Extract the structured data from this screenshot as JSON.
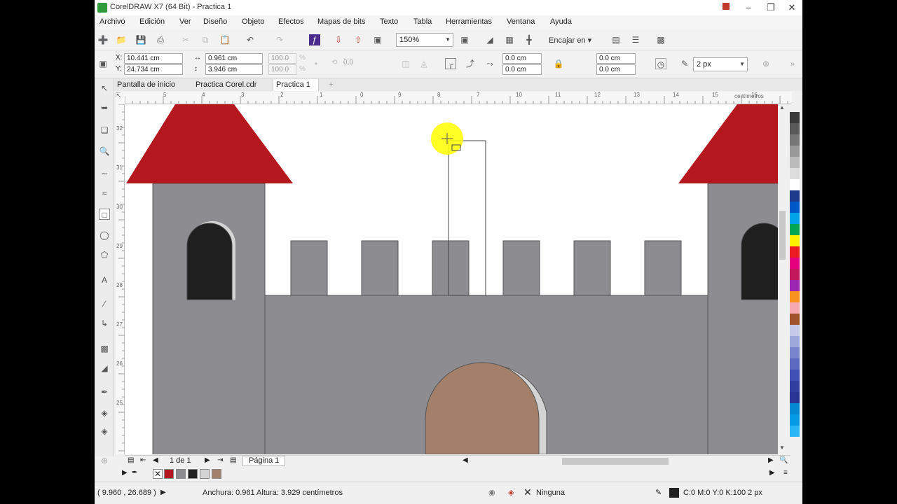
{
  "window": {
    "title": "CorelDRAW X7 (64 Bit) - Practica 1"
  },
  "menu": [
    "Archivo",
    "Edición",
    "Ver",
    "Diseño",
    "Objeto",
    "Efectos",
    "Mapas de bits",
    "Texto",
    "Tabla",
    "Herramientas",
    "Ventana",
    "Ayuda"
  ],
  "standard_toolbar": {
    "zoom": "150%",
    "snap_label": "Encajar en"
  },
  "property_bar": {
    "x_label": "X:",
    "x_value": "10.441 cm",
    "y_label": "Y:",
    "y_value": "24.734 cm",
    "width_value": "0.961 cm",
    "height_value": "3.946 cm",
    "scale_w": "100.0",
    "scale_h": "100.0",
    "pct": "%",
    "rotation": "0.0",
    "corner1": "0.0 cm",
    "corner2": "0.0 cm",
    "corner3": "0.0 cm",
    "corner4": "0.0 cm",
    "outline_width": "2 px"
  },
  "tabs": [
    "Pantalla de inicio",
    "Practica Corel.cdr",
    "Practica 1"
  ],
  "active_tab": "Practica 1",
  "ruler": {
    "unit": "centímetros",
    "h_ticks": [
      "5",
      "4",
      "3",
      "2",
      "1",
      "0",
      "9",
      "8",
      "7",
      "10",
      "11",
      "12",
      "13",
      "14",
      "15",
      "16",
      "17"
    ],
    "v_ticks": [
      "32",
      "31",
      "30",
      "29",
      "28",
      "27",
      "26",
      "25"
    ],
    "v_unit": "centímetros"
  },
  "page_nav": {
    "counter": "1 de 1",
    "page_tab": "Página 1"
  },
  "document_palette": {
    "colors": [
      "#b5171e",
      "#8d8d91",
      "#1f1f1f",
      "#d4d4d4",
      "#a47f6a"
    ]
  },
  "status": {
    "cursor": "( 9.960 , 26.689 )",
    "dimensions": "Anchura: 0.961  Altura: 3.929  centímetros",
    "fill": "Ninguna",
    "outline": "C:0 M:0 Y:0 K:100  2 px"
  },
  "drawing_colors": {
    "roof": "#b5171e",
    "stone": "#8d8d91",
    "window": "#1f1f1f",
    "door": "#a47f6a",
    "highlight": "#d4d4d4",
    "cursor_halo": "#ffff00"
  },
  "color_palette": [
    "#3a3a3a",
    "#5a5a5a",
    "#777777",
    "#999999",
    "#bbbbbb",
    "#dddddd",
    "#ffffff",
    "#1e3a8a",
    "#0059c9",
    "#00a2e8",
    "#00a651",
    "#fff200",
    "#ed1c24",
    "#e6007e",
    "#c2185b",
    "#9c27b0",
    "#f7931e",
    "#f6a8b0",
    "#a0522d",
    "#c5cae9",
    "#9fa8da",
    "#7986cb",
    "#5c6bc0",
    "#3f51b5",
    "#303f9f",
    "#283593",
    "#0288d1",
    "#039be5",
    "#29b6f6"
  ]
}
